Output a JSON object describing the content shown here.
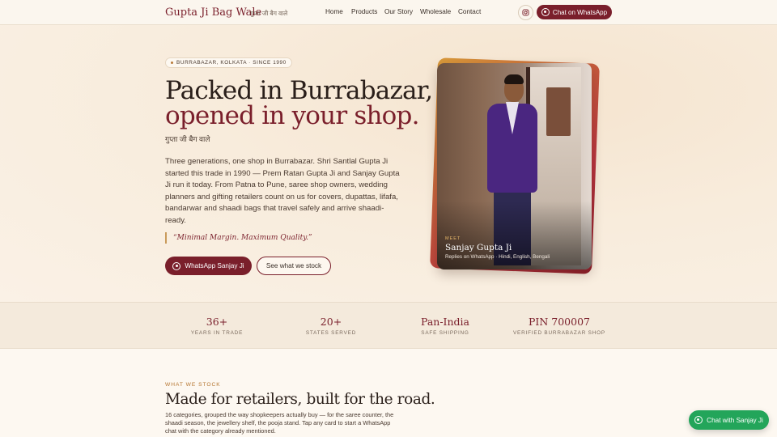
{
  "nav": {
    "brand": "Gupta Ji Bag Wale",
    "brand_hindi": "गुप्ता जी बैग वाले",
    "links": [
      "Home",
      "Products",
      "Our Story",
      "Wholesale",
      "Contact"
    ],
    "instagram_icon": "instagram-icon",
    "whatsapp_cta": "Chat on WhatsApp"
  },
  "hero": {
    "badge": "BURRABAZAR, KOLKATA · SINCE 1990",
    "headline_line1": "Packed in Burrabazar,",
    "headline_line2": "opened in your shop.",
    "hindi_tagline": "गुप्ता जी बैग वाले",
    "description": "Three generations, one shop in Burrabazar. Shri Santlal Gupta Ji started this trade in 1990 — Prem Ratan Gupta Ji and Sanjay Gupta Ji run it today. From Patna to Pune, saree shop owners, wedding planners and gifting retailers count on us for covers, dupattas, lifafa, bandarwar and shaadi bags that travel safely and arrive shaadi-ready.",
    "quote": "“Minimal Margin. Maximum Quality.”",
    "primary_cta": "WhatsApp Sanjay Ji",
    "secondary_cta": "See what we stock",
    "card": {
      "eyebrow": "MEET",
      "name": "Sanjay Gupta Ji",
      "subtitle": "Replies on WhatsApp · Hindi, English, Bengali"
    }
  },
  "stats": [
    {
      "value": "36+",
      "label": "YEARS IN TRADE"
    },
    {
      "value": "20+",
      "label": "STATES SERVED"
    },
    {
      "value": "Pan-India",
      "label": "SAFE SHIPPING"
    },
    {
      "value": "PIN 700007",
      "label": "VERIFIED BURRABAZAR SHOP"
    }
  ],
  "section": {
    "eyebrow": "WHAT WE STOCK",
    "title": "Made for retailers, built for the road.",
    "body": "16 categories, grouped the way shopkeepers actually buy — for the saree counter, the shaadi season, the jewellery shelf, the pooja stand. Tap any card to start a WhatsApp chat with the category already mentioned."
  },
  "floating_chat": "Chat with Sanjay Ji",
  "colors": {
    "brand_maroon": "#7a1f2b",
    "accent_gold": "#b5752f",
    "whatsapp_green": "#23a55a",
    "background": "#fbf4ea"
  }
}
